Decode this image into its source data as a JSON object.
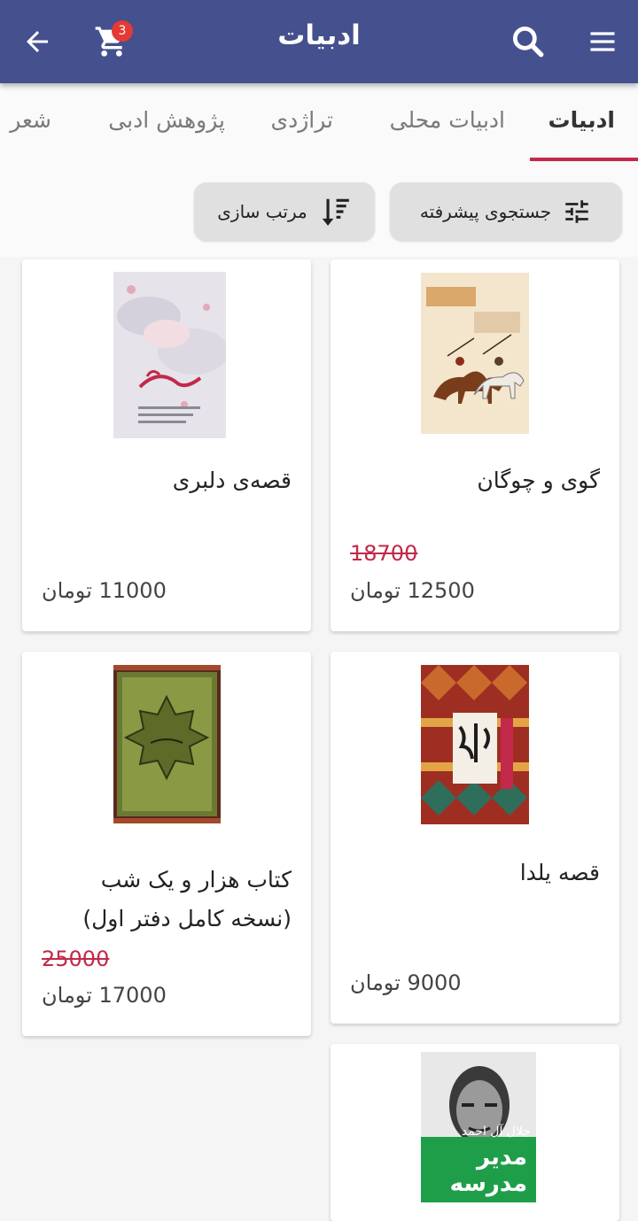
{
  "header": {
    "title": "ادبیات",
    "cart_count": "3",
    "icons": [
      "back-arrow-icon",
      "cart-icon",
      "search-icon",
      "menu-icon"
    ],
    "color": "#45508e"
  },
  "tabs": [
    "ادبیات",
    "ادبیات محلی",
    "تراژدی",
    "پژوهش ادبی",
    "شعر"
  ],
  "active_tab": 0,
  "filters": {
    "advanced_search": "جستجوی پیشرفته",
    "sort": "مرتب سازی"
  },
  "books": [
    {
      "title": "گوی و چوگان",
      "old_price": "18700",
      "price": "12500 تومان"
    },
    {
      "title": "قصه‌ی دلبری",
      "old_price": "",
      "price": "11000 تومان"
    },
    {
      "title": "قصه یلدا",
      "old_price": "",
      "price": "9000 تومان"
    },
    {
      "title": "کتاب هزار و یک شب (نسخه کامل دفتر اول)",
      "old_price": "25000",
      "price": "17000 تومان"
    }
  ],
  "partial_book": {
    "cover_author": "جلال آل احمد",
    "cover_title": "مدیر مدرسه"
  },
  "accent_color": "#c2294a"
}
